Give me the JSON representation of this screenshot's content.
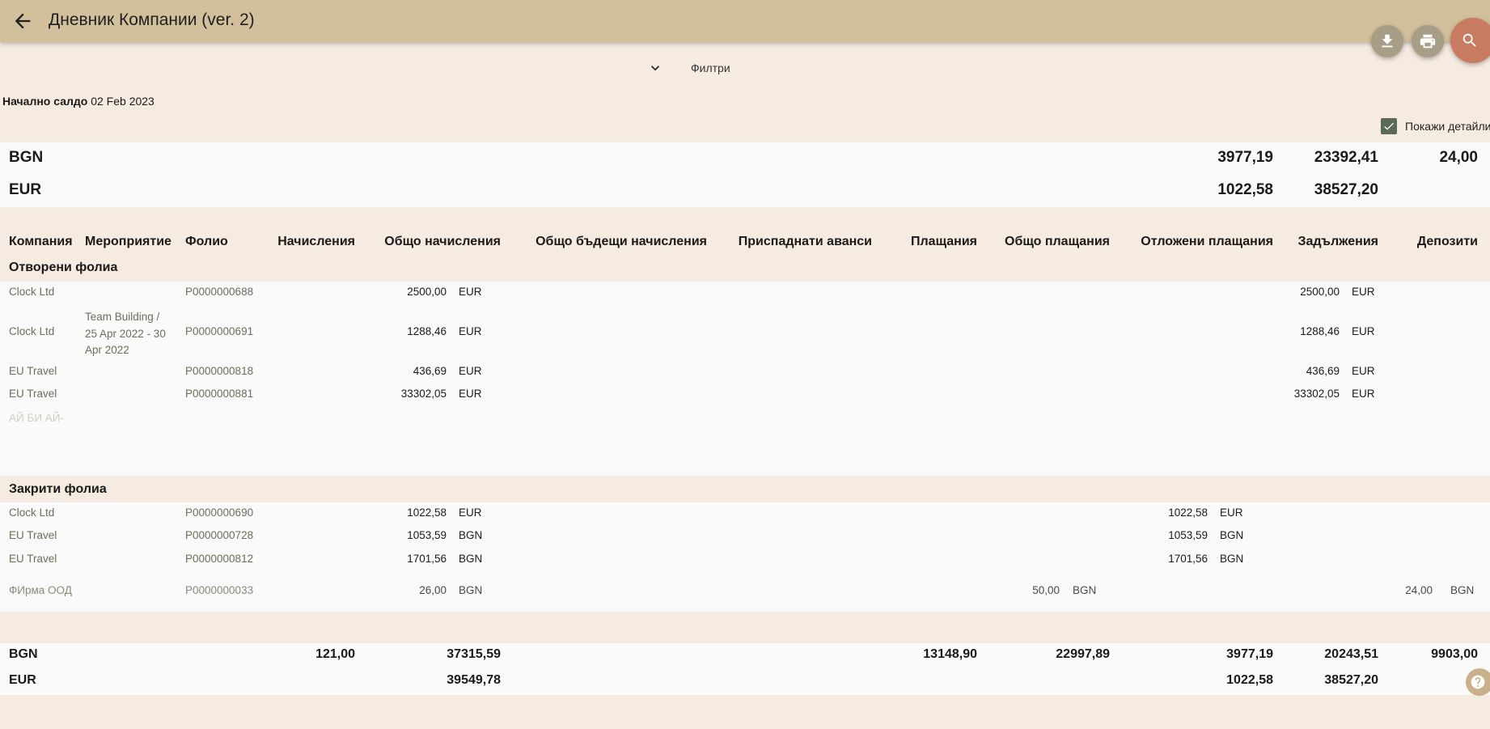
{
  "header": {
    "title": "Дневник Компании (ver. 2)"
  },
  "icons": {
    "back": "arrow-left-icon",
    "download": "download-icon",
    "print": "print-icon",
    "search": "search-icon",
    "help": "help-icon",
    "chevron": "chevron-down-icon",
    "check": "check-icon"
  },
  "filters": {
    "label": "Филтри"
  },
  "opening_balance": {
    "label": "Начално салдо",
    "date": "02 Feb 2023"
  },
  "show_details": {
    "label": "Покажи детайли",
    "checked": true
  },
  "summary": [
    {
      "currency": "BGN",
      "values": [
        "3977,19",
        "23392,41",
        "24,00"
      ]
    },
    {
      "currency": "EUR",
      "values": [
        "1022,58",
        "38527,20",
        ""
      ]
    }
  ],
  "columns": [
    "Компания",
    "Мероприятие",
    "Фолио",
    "Начисления",
    "Общо начисления",
    "Общо бъдещи начисления",
    "Приспаднати аванси",
    "Плащания",
    "Общо плащания",
    "Отложени плащания",
    "Задължения",
    "Депозити"
  ],
  "open_folios": {
    "title": "Отворени фолиа",
    "rows": [
      {
        "company": "Clock Ltd",
        "event": "",
        "folio": "P0000000688",
        "total_charges": "2500,00",
        "total_charges_cur": "EUR",
        "debts": "2500,00",
        "debts_cur": "EUR"
      },
      {
        "company": "Clock Ltd",
        "event_lines": [
          "Team Building /",
          "25 Apr 2022 - 30",
          "Apr 2022"
        ],
        "folio": "P0000000691",
        "total_charges": "1288,46",
        "total_charges_cur": "EUR",
        "debts": "1288,46",
        "debts_cur": "EUR"
      },
      {
        "company": "EU Travel",
        "event": "",
        "folio": "P0000000818",
        "total_charges": "436,69",
        "total_charges_cur": "EUR",
        "debts": "436,69",
        "debts_cur": "EUR"
      },
      {
        "company": "EU Travel",
        "event": "",
        "folio": "P0000000881",
        "total_charges": "33302,05",
        "total_charges_cur": "EUR",
        "debts": "33302,05",
        "debts_cur": "EUR"
      }
    ],
    "faded_company": "АЙ БИ АЙ-"
  },
  "closed_folios": {
    "title": "Закрити фолиа",
    "rows": [
      {
        "company": "Clock Ltd",
        "folio": "P0000000690",
        "total_charges": "1022,58",
        "total_charges_cur": "EUR",
        "deferred": "1022,58",
        "deferred_cur": "EUR"
      },
      {
        "company": "EU Travel",
        "folio": "P0000000728",
        "total_charges": "1053,59",
        "total_charges_cur": "BGN",
        "deferred": "1053,59",
        "deferred_cur": "BGN"
      },
      {
        "company": "EU Travel",
        "folio": "P0000000812",
        "total_charges": "1701,56",
        "total_charges_cur": "BGN",
        "deferred": "1701,56",
        "deferred_cur": "BGN"
      },
      {
        "company": "ФИрма ООД",
        "folio": "P0000000033",
        "total_charges": "26,00",
        "total_charges_cur": "BGN",
        "total_payments": "50,00",
        "total_payments_cur": "BGN",
        "deposits": "24,00",
        "deposits_cur": "BGN"
      }
    ]
  },
  "totals": [
    {
      "currency": "BGN",
      "charges": "121,00",
      "total_charges": "37315,59",
      "payments": "13148,90",
      "total_payments": "22997,89",
      "deferred": "3977,19",
      "debts": "20243,51",
      "deposits": "9903,00"
    },
    {
      "currency": "EUR",
      "charges": "",
      "total_charges": "39549,78",
      "payments": "",
      "total_payments": "",
      "deferred": "1022,58",
      "debts": "38527,20",
      "deposits": ""
    }
  ]
}
